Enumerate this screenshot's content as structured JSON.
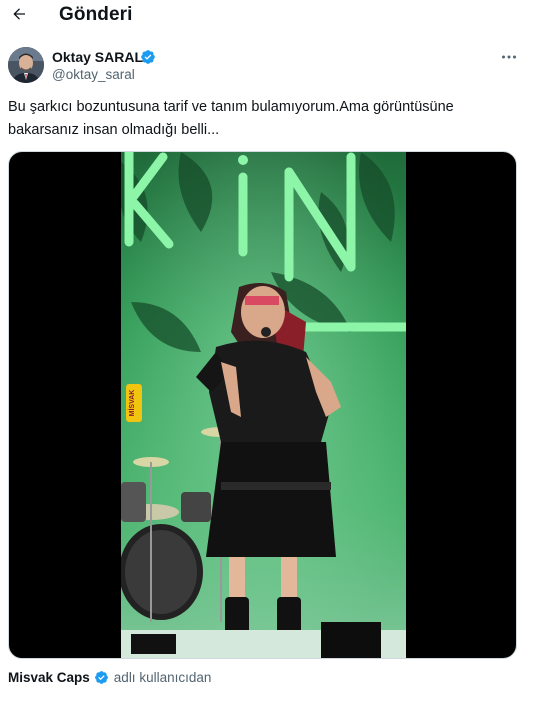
{
  "header": {
    "title": "Gönderi",
    "back_icon": "arrow-left-icon"
  },
  "post": {
    "author_name": "Oktay SARAL",
    "author_handle": "@oktay_saral",
    "verified": true,
    "text_line1": "Bu şarkıcı bozuntusuna tarif ve tanım bulamıyorum.Ama görüntüsüne",
    "text_line2": "bakarsanız insan olmadığı belli...",
    "more_icon": "more-horizontal-icon",
    "media": {
      "type": "video",
      "stage_letters": "KİN",
      "watermark": "MİSVAK"
    }
  },
  "attribution": {
    "source_name": "Misvak Caps",
    "source_verified": true,
    "suffix": "adlı kullanıcıdan"
  },
  "colors": {
    "text_primary": "#0f1419",
    "text_secondary": "#536471",
    "verified_blue": "#1d9bf0",
    "stage_green": "#2fae5b",
    "border": "#cfd9de"
  }
}
